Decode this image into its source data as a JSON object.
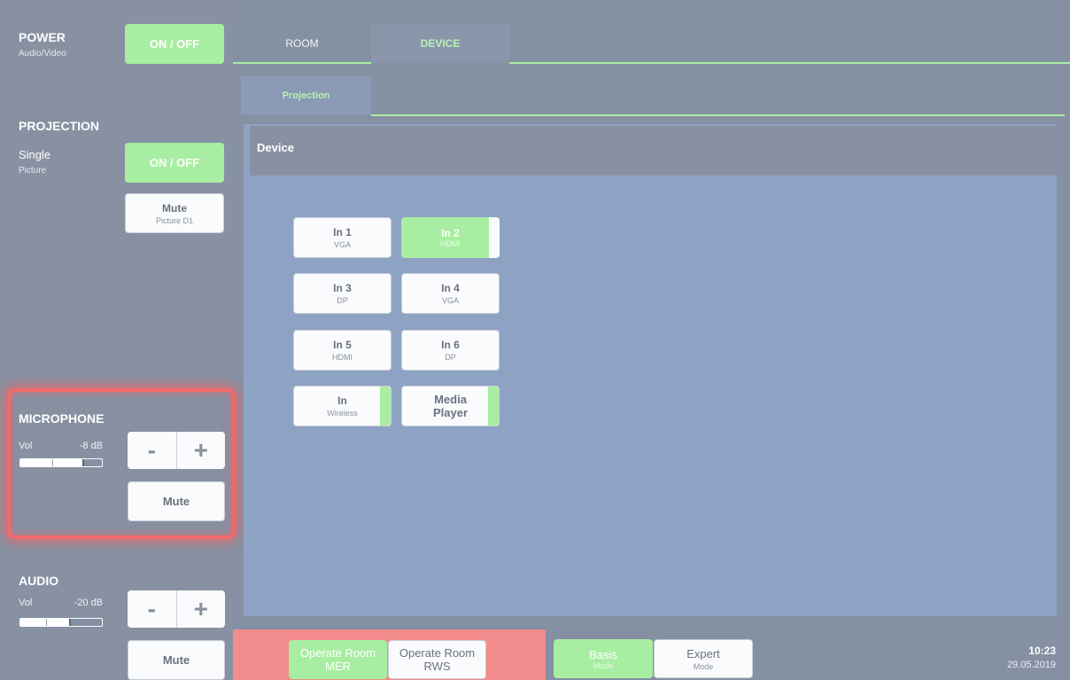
{
  "power": {
    "title": "POWER",
    "subtitle": "Audio/Video",
    "button": "ON / OFF"
  },
  "projection": {
    "title": "PROJECTION",
    "mode": "Single",
    "mode_sub": "Picture",
    "button": "ON / OFF",
    "mute": {
      "label": "Mute",
      "sub": "Picture D1"
    }
  },
  "microphone": {
    "title": "MICROPHONE",
    "vol_label": "Vol",
    "vol_value": "-8 dB",
    "vol_level": 0.78,
    "minus": "-",
    "plus": "+",
    "mute": "Mute"
  },
  "audio": {
    "title": "AUDIO",
    "vol_label": "Vol",
    "vol_value": "-20 dB",
    "vol_level": 0.62,
    "minus": "-",
    "plus": "+",
    "mute": "Mute"
  },
  "tabs": {
    "room": "ROOM",
    "device": "DEVICE",
    "projection": "Projection"
  },
  "panel": {
    "header": "Device"
  },
  "inputs": [
    {
      "title": "In 1",
      "sub": "VGA",
      "active": false
    },
    {
      "title": "In 2",
      "sub": "HDMI",
      "active": true
    },
    {
      "title": "In 3",
      "sub": "DP",
      "active": false
    },
    {
      "title": "In 4",
      "sub": "VGA",
      "active": false
    },
    {
      "title": "In 5",
      "sub": "HDMI",
      "active": false
    },
    {
      "title": "In 6",
      "sub": "DP",
      "active": false
    },
    {
      "title": "In",
      "sub": "Wireless",
      "active": false
    },
    {
      "title": "Media Player",
      "sub": "",
      "active": false
    }
  ],
  "footer": {
    "operate_mer": "Operate Room MER",
    "operate_rws": "Operate Room RWS",
    "basis": {
      "label": "Basis",
      "sub": "Mode"
    },
    "expert": {
      "label": "Expert",
      "sub": "Mode"
    },
    "time": "10:23",
    "date": "29.05.2019"
  },
  "colors": {
    "accent_green": "#a8eea2",
    "highlight_red": "#f26a6a",
    "footer_red": "#f28b8b",
    "panel_blue": "#8ea2c4"
  }
}
